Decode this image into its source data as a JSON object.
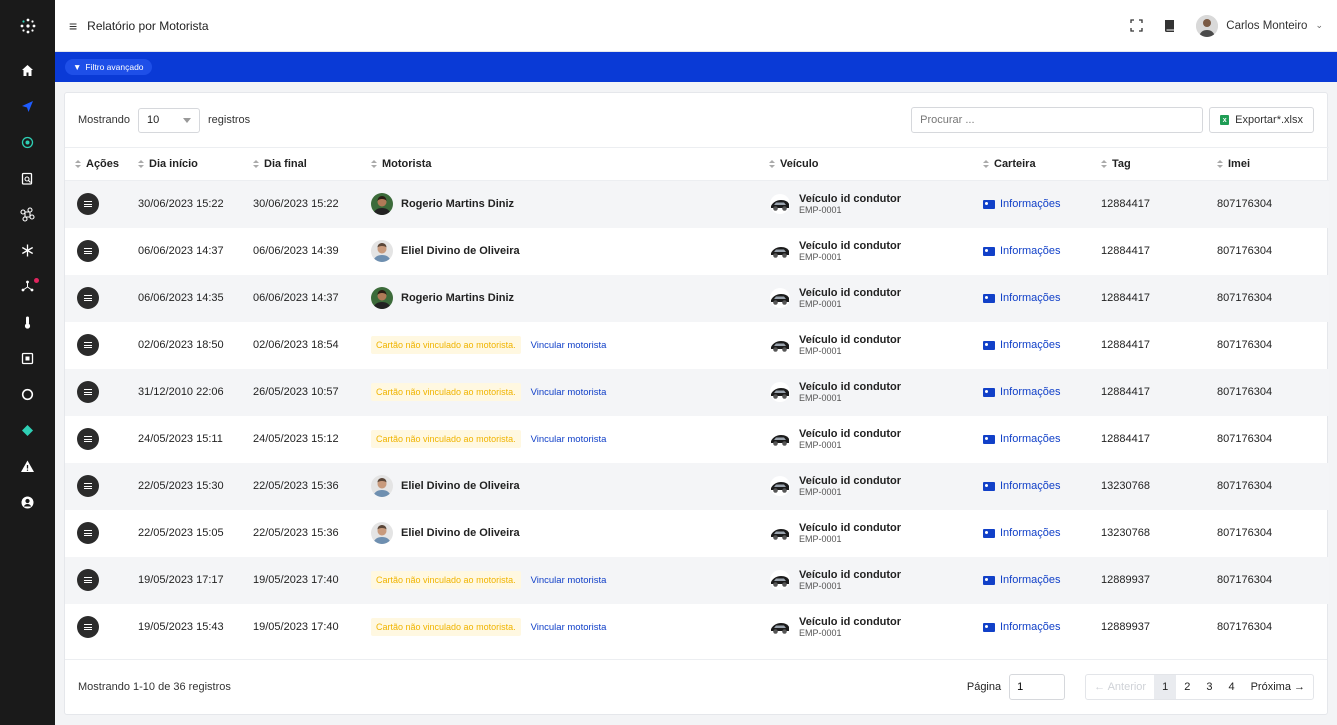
{
  "header": {
    "title": "Relatório por Motorista",
    "user_name": "Carlos Monteiro"
  },
  "filter": {
    "label": "Filtro avançado"
  },
  "sidebar": {
    "items": [
      {
        "icon": "home-icon"
      },
      {
        "icon": "location-arrow-icon"
      },
      {
        "icon": "target-icon"
      },
      {
        "icon": "clipboard-search-icon"
      },
      {
        "icon": "command-icon"
      },
      {
        "icon": "snowflake-icon"
      },
      {
        "icon": "network-icon"
      },
      {
        "icon": "thermometer-icon"
      },
      {
        "icon": "chip-icon"
      },
      {
        "icon": "circle-icon"
      },
      {
        "icon": "diamond-icon"
      },
      {
        "icon": "warning-icon"
      },
      {
        "icon": "user-circle-icon"
      }
    ]
  },
  "controls": {
    "show_label": "Mostrando",
    "page_size": "10",
    "records_label": "registros",
    "search_placeholder": "Procurar ...",
    "export_label": "Exportar*.xlsx"
  },
  "table": {
    "columns": [
      "Ações",
      "Dia início",
      "Dia final",
      "Motorista",
      "Veículo",
      "Carteira",
      "Tag",
      "Imei"
    ],
    "unlinked_text": "Cartão não vinculado ao motorista.",
    "link_driver": "Vincular motorista",
    "vehicle_name": "Veículo id condutor",
    "vehicle_code": "EMP-0001",
    "wallet_label": "Informações",
    "rows": [
      {
        "start": "30/06/2023 15:22",
        "end": "30/06/2023 15:22",
        "driver": "Rogerio Martins Diniz",
        "photo": "a",
        "tag": "12884417",
        "imei": "807176304"
      },
      {
        "start": "06/06/2023 14:37",
        "end": "06/06/2023 14:39",
        "driver": "Eliel Divino de Oliveira",
        "photo": "b",
        "tag": "12884417",
        "imei": "807176304"
      },
      {
        "start": "06/06/2023 14:35",
        "end": "06/06/2023 14:37",
        "driver": "Rogerio Martins Diniz",
        "photo": "a",
        "tag": "12884417",
        "imei": "807176304"
      },
      {
        "start": "02/06/2023 18:50",
        "end": "02/06/2023 18:54",
        "driver": null,
        "photo": null,
        "tag": "12884417",
        "imei": "807176304"
      },
      {
        "start": "31/12/2010 22:06",
        "end": "26/05/2023 10:57",
        "driver": null,
        "photo": null,
        "tag": "12884417",
        "imei": "807176304"
      },
      {
        "start": "24/05/2023 15:11",
        "end": "24/05/2023 15:12",
        "driver": null,
        "photo": null,
        "tag": "12884417",
        "imei": "807176304"
      },
      {
        "start": "22/05/2023 15:30",
        "end": "22/05/2023 15:36",
        "driver": "Eliel Divino de Oliveira",
        "photo": "b",
        "tag": "13230768",
        "imei": "807176304"
      },
      {
        "start": "22/05/2023 15:05",
        "end": "22/05/2023 15:36",
        "driver": "Eliel Divino de Oliveira",
        "photo": "b",
        "tag": "13230768",
        "imei": "807176304"
      },
      {
        "start": "19/05/2023 17:17",
        "end": "19/05/2023 17:40",
        "driver": null,
        "photo": null,
        "tag": "12889937",
        "imei": "807176304"
      },
      {
        "start": "19/05/2023 15:43",
        "end": "19/05/2023 17:40",
        "driver": null,
        "photo": null,
        "tag": "12889937",
        "imei": "807176304"
      }
    ]
  },
  "footer": {
    "summary": "Mostrando 1-10 de 36 registros",
    "page_label": "Página",
    "page_value": "1",
    "prev_label": "← Anterior",
    "pages": [
      "1",
      "2",
      "3",
      "4"
    ],
    "current_page": "1",
    "next_label": "Próxima →"
  },
  "colors": {
    "sidebar_bg": "#1a1a1a",
    "filter_bar": "#0a3ad6",
    "link_blue": "#1140c8",
    "warning_yellow": "#f0b400",
    "excel_green": "#1f9d55"
  }
}
